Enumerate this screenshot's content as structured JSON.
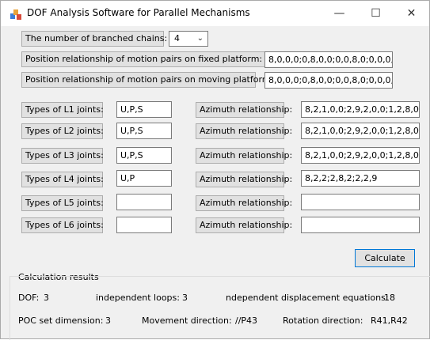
{
  "window": {
    "title": "DOF Analysis Software for Parallel Mechanisms",
    "minimize_glyph": "—",
    "maximize_glyph": "☐",
    "close_glyph": "✕"
  },
  "config": {
    "branched_label": "The number of branched chains:",
    "branched_value": "4",
    "fixed_label": "Position relationship of motion pairs on fixed platform:",
    "fixed_value": "8,0,0,0;0,8,0,0;0,0,8,0;0,0,0,",
    "moving_label": "Position relationship of motion pairs on moving platform:",
    "moving_value": "8,0,0,0;0,8,0,0;0,0,8,0;0,0,0,"
  },
  "legs": [
    {
      "label": "Types of L1 joints:",
      "value": "U,P,S",
      "azimuth_label": "Azimuth relationship:",
      "azimuth_value": "8,2,1,0,0;2,9,2,0,0;1,2,8,0"
    },
    {
      "label": "Types of L2 joints:",
      "value": "U,P,S",
      "azimuth_label": "Azimuth relationship:",
      "azimuth_value": "8,2,1,0,0;2,9,2,0,0;1,2,8,0"
    },
    {
      "label": "Types of L3 joints:",
      "value": "U,P,S",
      "azimuth_label": "Azimuth relationship:",
      "azimuth_value": "8,2,1,0,0;2,9,2,0,0;1,2,8,0"
    },
    {
      "label": "Types of L4 joints:",
      "value": "U,P",
      "azimuth_label": "Azimuth relationship:",
      "azimuth_value": "8,2,2;2,8,2;2,2,9"
    },
    {
      "label": "Types of L5 joints:",
      "value": "",
      "azimuth_label": "Azimuth relationship:",
      "azimuth_value": ""
    },
    {
      "label": "Types of L6 joints:",
      "value": "",
      "azimuth_label": "Azimuth relationship:",
      "azimuth_value": ""
    }
  ],
  "calculate_label": "Calculate",
  "results": {
    "group_title": "Calculation results",
    "dof_label": "DOF:",
    "dof_value": "3",
    "loops_label": "independent loops:",
    "loops_value": "3",
    "equations_label": "ndependent displacement equations:",
    "equations_value": "18",
    "poc_label": "POC set dimension:",
    "poc_value": "3",
    "movement_label": "Movement direction:",
    "movement_value": "//P43",
    "rotation_label": "Rotation direction:",
    "rotation_value": "R41,R42"
  }
}
